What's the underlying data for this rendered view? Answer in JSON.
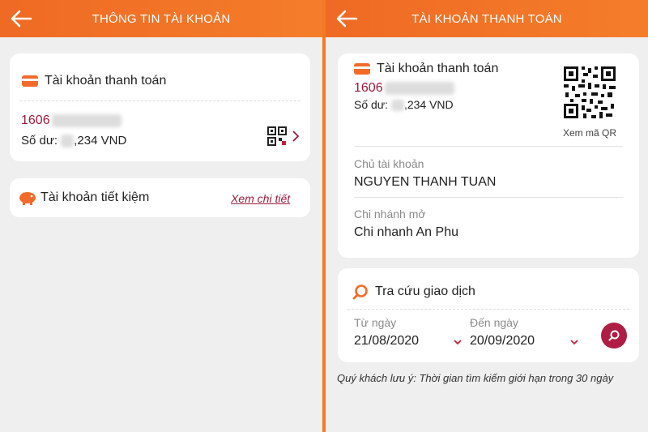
{
  "left": {
    "header": {
      "title": "THÔNG TIN TÀI KHOẢN"
    },
    "payment_card": {
      "title": "Tài khoản thanh toán",
      "account_prefix": "1606",
      "balance_label": "Số dư:",
      "balance_suffix": ",234 VND",
      "qr_icon": "qr-code-icon",
      "chevron_icon": "chevron-right-icon"
    },
    "savings_card": {
      "title": "Tài khoản tiết kiệm",
      "link": "Xem chi tiết",
      "icon": "piggy-bank-icon"
    }
  },
  "right": {
    "header": {
      "title": "TÀI KHOẢN THANH TOÁN"
    },
    "account_card": {
      "title": "Tài khoản thanh toán",
      "account_prefix": "1606",
      "balance_label": "Số dư:",
      "balance_suffix": ",234 VND",
      "qr_caption": "Xem mã QR",
      "owner_label": "Chủ tài khoản",
      "owner_value": "NGUYEN THANH TUAN",
      "branch_label": "Chi nhánh mở",
      "branch_value": "Chi nhanh An Phu"
    },
    "lookup_card": {
      "title": "Tra cứu giao dịch",
      "from_label": "Từ ngày",
      "from_value": "21/08/2020",
      "to_label": "Đến ngày",
      "to_value": "20/09/2020"
    },
    "note": "Quý khách lưu ý: Thời gian tìm kiếm giới hạn trong 30 ngày"
  },
  "colors": {
    "header": "#f47a22",
    "accent": "#9b1b3a",
    "search_button": "#b01d44",
    "card_icon": "#f26b2b"
  }
}
